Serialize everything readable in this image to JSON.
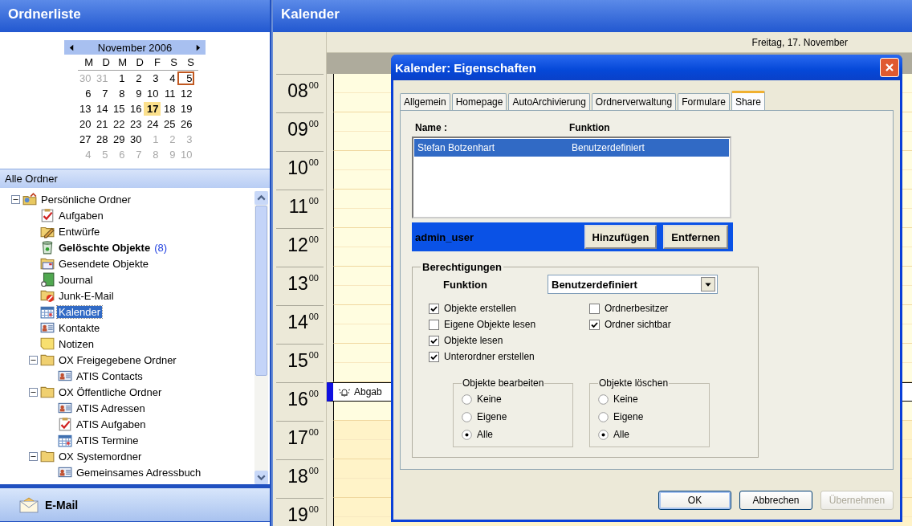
{
  "sidebar": {
    "title": "Ordnerliste",
    "mini_calendar": {
      "month": "November 2006",
      "weekdays": [
        "M",
        "D",
        "M",
        "D",
        "F",
        "S",
        "S"
      ],
      "weeks": [
        [
          {
            "d": "30",
            "other_month": true,
            "today": false,
            "selected": false
          },
          {
            "d": "31",
            "other_month": true,
            "today": false,
            "selected": false
          },
          {
            "d": "1",
            "other_month": false,
            "today": false,
            "selected": false
          },
          {
            "d": "2",
            "other_month": false,
            "today": false,
            "selected": false
          },
          {
            "d": "3",
            "other_month": false,
            "today": false,
            "selected": false
          },
          {
            "d": "4",
            "other_month": false,
            "today": false,
            "selected": false
          },
          {
            "d": "5",
            "other_month": false,
            "today": false,
            "selected": true
          }
        ],
        [
          {
            "d": "6",
            "other_month": false,
            "today": false,
            "selected": false
          },
          {
            "d": "7",
            "other_month": false,
            "today": false,
            "selected": false
          },
          {
            "d": "8",
            "other_month": false,
            "today": false,
            "selected": false
          },
          {
            "d": "9",
            "other_month": false,
            "today": false,
            "selected": false
          },
          {
            "d": "10",
            "other_month": false,
            "today": false,
            "selected": false
          },
          {
            "d": "11",
            "other_month": false,
            "today": false,
            "selected": false
          },
          {
            "d": "12",
            "other_month": false,
            "today": false,
            "selected": false
          }
        ],
        [
          {
            "d": "13",
            "other_month": false,
            "today": false,
            "selected": false
          },
          {
            "d": "14",
            "other_month": false,
            "today": false,
            "selected": false
          },
          {
            "d": "15",
            "other_month": false,
            "today": false,
            "selected": false
          },
          {
            "d": "16",
            "other_month": false,
            "today": false,
            "selected": false
          },
          {
            "d": "17",
            "other_month": false,
            "today": true,
            "selected": false
          },
          {
            "d": "18",
            "other_month": false,
            "today": false,
            "selected": false
          },
          {
            "d": "19",
            "other_month": false,
            "today": false,
            "selected": false
          }
        ],
        [
          {
            "d": "20",
            "other_month": false,
            "today": false,
            "selected": false
          },
          {
            "d": "21",
            "other_month": false,
            "today": false,
            "selected": false
          },
          {
            "d": "22",
            "other_month": false,
            "today": false,
            "selected": false
          },
          {
            "d": "23",
            "other_month": false,
            "today": false,
            "selected": false
          },
          {
            "d": "24",
            "other_month": false,
            "today": false,
            "selected": false
          },
          {
            "d": "25",
            "other_month": false,
            "today": false,
            "selected": false
          },
          {
            "d": "26",
            "other_month": false,
            "today": false,
            "selected": false
          }
        ],
        [
          {
            "d": "27",
            "other_month": false,
            "today": false,
            "selected": false
          },
          {
            "d": "28",
            "other_month": false,
            "today": false,
            "selected": false
          },
          {
            "d": "29",
            "other_month": false,
            "today": false,
            "selected": false
          },
          {
            "d": "30",
            "other_month": false,
            "today": false,
            "selected": false
          },
          {
            "d": "1",
            "other_month": true,
            "today": false,
            "selected": false
          },
          {
            "d": "2",
            "other_month": true,
            "today": false,
            "selected": false
          },
          {
            "d": "3",
            "other_month": true,
            "today": false,
            "selected": false
          }
        ],
        [
          {
            "d": "4",
            "other_month": true,
            "today": false,
            "selected": false
          },
          {
            "d": "5",
            "other_month": true,
            "today": false,
            "selected": false
          },
          {
            "d": "6",
            "other_month": true,
            "today": false,
            "selected": false
          },
          {
            "d": "7",
            "other_month": true,
            "today": false,
            "selected": false
          },
          {
            "d": "8",
            "other_month": true,
            "today": false,
            "selected": false
          },
          {
            "d": "9",
            "other_month": true,
            "today": false,
            "selected": false
          },
          {
            "d": "10",
            "other_month": true,
            "today": false,
            "selected": false
          }
        ]
      ]
    },
    "section": "Alle Ordner",
    "tree": [
      {
        "label": "Persönliche Ordner",
        "kind": "home",
        "bold": false,
        "selected": false,
        "expanded": true,
        "children": [
          {
            "label": "Aufgaben",
            "kind": "tasks",
            "bold": false,
            "selected": false
          },
          {
            "label": "Entwürfe",
            "kind": "drafts",
            "bold": false,
            "selected": false
          },
          {
            "label": "Gelöschte Objekte",
            "kind": "trash",
            "bold": true,
            "count": "(8)",
            "selected": false
          },
          {
            "label": "Gesendete Objekte",
            "kind": "sent",
            "bold": false,
            "selected": false
          },
          {
            "label": "Journal",
            "kind": "journal",
            "bold": false,
            "selected": false
          },
          {
            "label": "Junk-E-Mail",
            "kind": "junk",
            "bold": false,
            "selected": false
          },
          {
            "label": "Kalender",
            "kind": "calendar",
            "bold": false,
            "selected": true
          },
          {
            "label": "Kontakte",
            "kind": "contacts",
            "bold": false,
            "selected": false
          },
          {
            "label": "Notizen",
            "kind": "notes",
            "bold": false,
            "selected": false
          },
          {
            "label": "OX Freigegebene Ordner",
            "kind": "folder",
            "bold": false,
            "selected": false,
            "expanded": true,
            "children": [
              {
                "label": "ATIS Contacts",
                "kind": "contacts",
                "bold": false,
                "selected": false
              }
            ]
          },
          {
            "label": "OX Öffentliche Ordner",
            "kind": "folder",
            "bold": false,
            "selected": false,
            "expanded": true,
            "children": [
              {
                "label": "ATIS Adressen",
                "kind": "contacts",
                "bold": false,
                "selected": false
              },
              {
                "label": "ATIS Aufgaben",
                "kind": "tasks",
                "bold": false,
                "selected": false
              },
              {
                "label": "ATIS Termine",
                "kind": "calendar",
                "bold": false,
                "selected": false
              }
            ]
          },
          {
            "label": "OX Systemordner",
            "kind": "folder",
            "bold": false,
            "selected": false,
            "expanded": true,
            "children": [
              {
                "label": "Gemeinsames Adressbuch",
                "kind": "contacts",
                "bold": false,
                "selected": false
              }
            ]
          }
        ]
      }
    ],
    "nav_button": "E-Mail"
  },
  "calendar": {
    "title": "Kalender",
    "day_header": "Freitag, 17. November",
    "hours": [
      {
        "hour": "08",
        "minutes": "00",
        "work_hours": true
      },
      {
        "hour": "09",
        "minutes": "00",
        "work_hours": true
      },
      {
        "hour": "10",
        "minutes": "00",
        "work_hours": true
      },
      {
        "hour": "11",
        "minutes": "00",
        "work_hours": true
      },
      {
        "hour": "12",
        "minutes": "00",
        "work_hours": true
      },
      {
        "hour": "13",
        "minutes": "00",
        "work_hours": true
      },
      {
        "hour": "14",
        "minutes": "00",
        "work_hours": true
      },
      {
        "hour": "15",
        "minutes": "00",
        "work_hours": true
      },
      {
        "hour": "16",
        "minutes": "00",
        "work_hours": true,
        "event": "Abgab"
      },
      {
        "hour": "17",
        "minutes": "00",
        "work_hours": false
      },
      {
        "hour": "18",
        "minutes": "00",
        "work_hours": false
      },
      {
        "hour": "19",
        "minutes": "00",
        "work_hours": false
      }
    ]
  },
  "dialog": {
    "title": "Kalender: Eigenschaften",
    "tabs": [
      {
        "label": "Allgemein",
        "selected": false
      },
      {
        "label": "Homepage",
        "selected": false
      },
      {
        "label": "AutoArchivierung",
        "selected": false
      },
      {
        "label": "Ordnerverwaltung",
        "selected": false
      },
      {
        "label": "Formulare",
        "selected": false
      },
      {
        "label": "Share",
        "selected": true
      }
    ],
    "list_columns": [
      "Name :",
      "Funktion"
    ],
    "list_rows": [
      {
        "name": "Stefan Botzenhart",
        "function": "Benutzerdefiniert",
        "selected": true
      }
    ],
    "user": "admin_user",
    "add_button": "Hinzufügen",
    "remove_button": "Entfernen",
    "permissions": {
      "legend": "Berechtigungen",
      "function_label": "Funktion",
      "function_value": "Benutzerdefiniert",
      "options_left": [
        {
          "label": "Objekte erstellen",
          "checked": true
        },
        {
          "label": "Eigene Objekte lesen",
          "checked": false
        },
        {
          "label": "Objekte lesen",
          "checked": true
        },
        {
          "label": "Unterordner erstellen",
          "checked": true
        }
      ],
      "options_right": [
        {
          "label": "Ordnerbesitzer",
          "checked": false
        },
        {
          "label": "Ordner sichtbar",
          "checked": true
        }
      ],
      "radio_groups": [
        {
          "legend": "Objekte bearbeiten",
          "options": [
            {
              "label": "Keine",
              "selected": false
            },
            {
              "label": "Eigene",
              "selected": false
            },
            {
              "label": "Alle",
              "selected": true
            }
          ]
        },
        {
          "legend": "Objekte löschen",
          "options": [
            {
              "label": "Keine",
              "selected": false
            },
            {
              "label": "Eigene",
              "selected": false
            },
            {
              "label": "Alle",
              "selected": true
            }
          ]
        }
      ]
    },
    "buttons": [
      {
        "label": "OK",
        "disabled": false,
        "default": true
      },
      {
        "label": "Abbrechen",
        "disabled": false,
        "default": false
      },
      {
        "label": "Übernehmen",
        "disabled": true,
        "default": false
      }
    ]
  }
}
